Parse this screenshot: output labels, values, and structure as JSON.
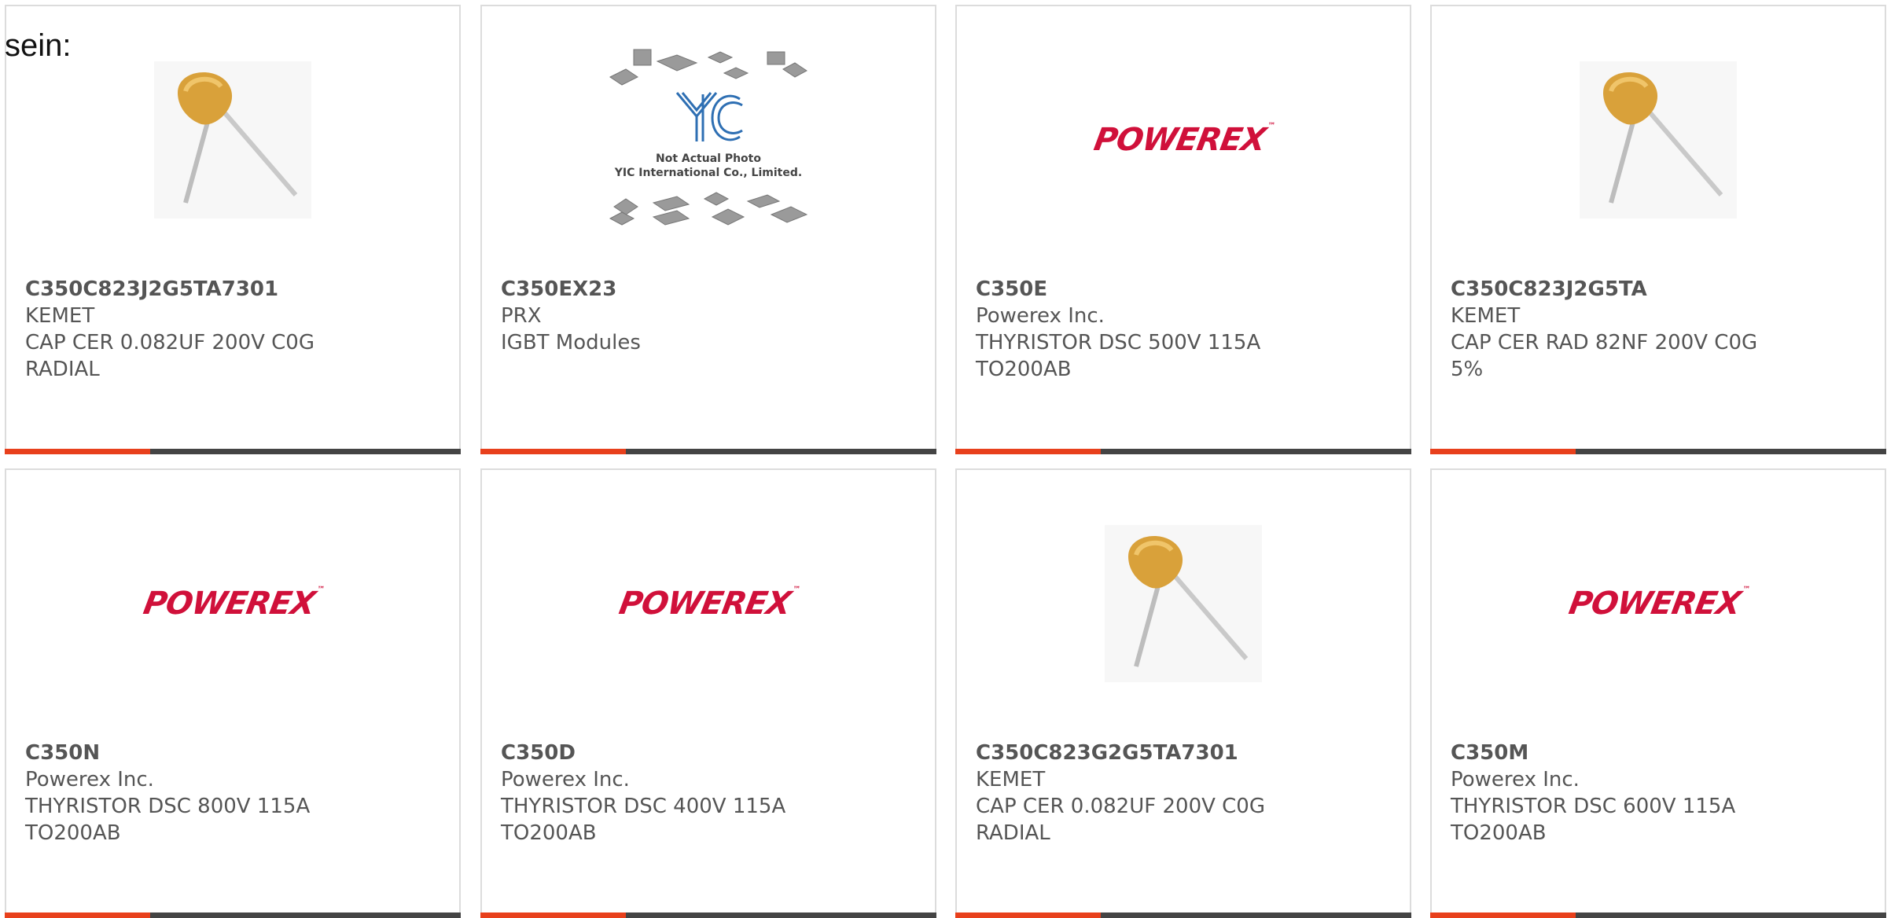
{
  "intro_text": "sein:",
  "brand_colors": {
    "accent": "#e8401c",
    "bar": "#444444",
    "powerex": "#d0103a"
  },
  "products": [
    {
      "part_number": "C350C823J2G5TA7301",
      "manufacturer": "KEMET",
      "desc_line1": "CAP CER 0.082UF 200V C0G",
      "desc_line2": "RADIAL",
      "image": "capacitor-photo"
    },
    {
      "part_number": "C350EX23",
      "manufacturer": "PRX",
      "desc_line1": "IGBT Modules",
      "desc_line2": "",
      "image": "yic-placeholder",
      "placeholder": {
        "logo": "YIC",
        "line1": "Not Actual Photo",
        "line2": "YIC International Co., Limited."
      }
    },
    {
      "part_number": "C350E",
      "manufacturer": "Powerex Inc.",
      "desc_line1": "THYRISTOR DSC 500V 115A",
      "desc_line2": "TO200AB",
      "image": "powerex-logo",
      "logo_text": "POWEREX"
    },
    {
      "part_number": "C350C823J2G5TA",
      "manufacturer": "KEMET",
      "desc_line1": "CAP CER RAD 82NF 200V C0G",
      "desc_line2": "5%",
      "image": "capacitor-photo"
    },
    {
      "part_number": "C350N",
      "manufacturer": "Powerex Inc.",
      "desc_line1": "THYRISTOR DSC 800V 115A",
      "desc_line2": "TO200AB",
      "image": "powerex-logo",
      "logo_text": "POWEREX"
    },
    {
      "part_number": "C350D",
      "manufacturer": "Powerex Inc.",
      "desc_line1": "THYRISTOR DSC 400V 115A",
      "desc_line2": "TO200AB",
      "image": "powerex-logo",
      "logo_text": "POWEREX"
    },
    {
      "part_number": "C350C823G2G5TA7301",
      "manufacturer": "KEMET",
      "desc_line1": "CAP CER 0.082UF 200V C0G",
      "desc_line2": "RADIAL",
      "image": "capacitor-photo"
    },
    {
      "part_number": "C350M",
      "manufacturer": "Powerex Inc.",
      "desc_line1": "THYRISTOR DSC 600V 115A",
      "desc_line2": "TO200AB",
      "image": "powerex-logo",
      "logo_text": "POWEREX"
    }
  ]
}
